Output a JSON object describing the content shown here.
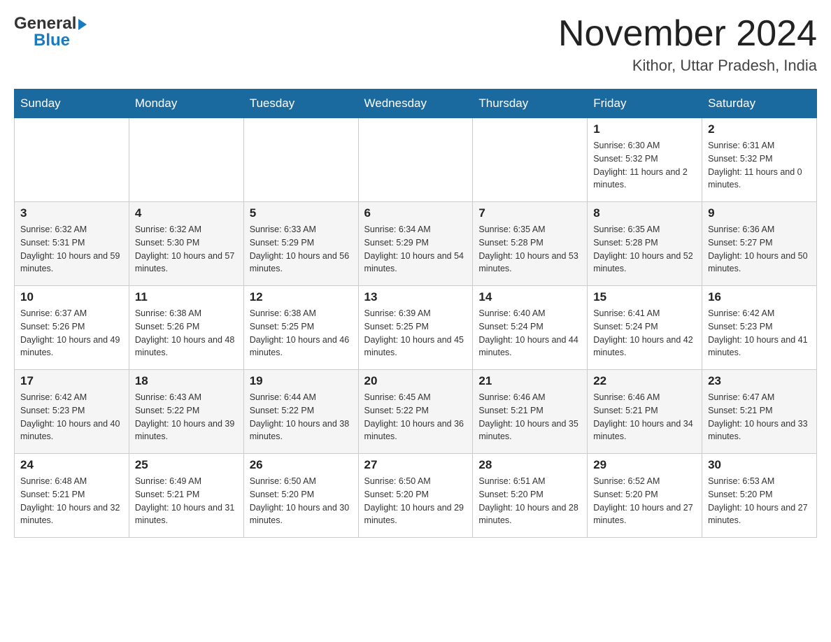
{
  "header": {
    "logo_general": "General",
    "logo_blue": "Blue",
    "month_title": "November 2024",
    "location": "Kithor, Uttar Pradesh, India"
  },
  "days_of_week": [
    "Sunday",
    "Monday",
    "Tuesday",
    "Wednesday",
    "Thursday",
    "Friday",
    "Saturday"
  ],
  "weeks": [
    [
      {
        "day": "",
        "info": ""
      },
      {
        "day": "",
        "info": ""
      },
      {
        "day": "",
        "info": ""
      },
      {
        "day": "",
        "info": ""
      },
      {
        "day": "",
        "info": ""
      },
      {
        "day": "1",
        "info": "Sunrise: 6:30 AM\nSunset: 5:32 PM\nDaylight: 11 hours and 2 minutes."
      },
      {
        "day": "2",
        "info": "Sunrise: 6:31 AM\nSunset: 5:32 PM\nDaylight: 11 hours and 0 minutes."
      }
    ],
    [
      {
        "day": "3",
        "info": "Sunrise: 6:32 AM\nSunset: 5:31 PM\nDaylight: 10 hours and 59 minutes."
      },
      {
        "day": "4",
        "info": "Sunrise: 6:32 AM\nSunset: 5:30 PM\nDaylight: 10 hours and 57 minutes."
      },
      {
        "day": "5",
        "info": "Sunrise: 6:33 AM\nSunset: 5:29 PM\nDaylight: 10 hours and 56 minutes."
      },
      {
        "day": "6",
        "info": "Sunrise: 6:34 AM\nSunset: 5:29 PM\nDaylight: 10 hours and 54 minutes."
      },
      {
        "day": "7",
        "info": "Sunrise: 6:35 AM\nSunset: 5:28 PM\nDaylight: 10 hours and 53 minutes."
      },
      {
        "day": "8",
        "info": "Sunrise: 6:35 AM\nSunset: 5:28 PM\nDaylight: 10 hours and 52 minutes."
      },
      {
        "day": "9",
        "info": "Sunrise: 6:36 AM\nSunset: 5:27 PM\nDaylight: 10 hours and 50 minutes."
      }
    ],
    [
      {
        "day": "10",
        "info": "Sunrise: 6:37 AM\nSunset: 5:26 PM\nDaylight: 10 hours and 49 minutes."
      },
      {
        "day": "11",
        "info": "Sunrise: 6:38 AM\nSunset: 5:26 PM\nDaylight: 10 hours and 48 minutes."
      },
      {
        "day": "12",
        "info": "Sunrise: 6:38 AM\nSunset: 5:25 PM\nDaylight: 10 hours and 46 minutes."
      },
      {
        "day": "13",
        "info": "Sunrise: 6:39 AM\nSunset: 5:25 PM\nDaylight: 10 hours and 45 minutes."
      },
      {
        "day": "14",
        "info": "Sunrise: 6:40 AM\nSunset: 5:24 PM\nDaylight: 10 hours and 44 minutes."
      },
      {
        "day": "15",
        "info": "Sunrise: 6:41 AM\nSunset: 5:24 PM\nDaylight: 10 hours and 42 minutes."
      },
      {
        "day": "16",
        "info": "Sunrise: 6:42 AM\nSunset: 5:23 PM\nDaylight: 10 hours and 41 minutes."
      }
    ],
    [
      {
        "day": "17",
        "info": "Sunrise: 6:42 AM\nSunset: 5:23 PM\nDaylight: 10 hours and 40 minutes."
      },
      {
        "day": "18",
        "info": "Sunrise: 6:43 AM\nSunset: 5:22 PM\nDaylight: 10 hours and 39 minutes."
      },
      {
        "day": "19",
        "info": "Sunrise: 6:44 AM\nSunset: 5:22 PM\nDaylight: 10 hours and 38 minutes."
      },
      {
        "day": "20",
        "info": "Sunrise: 6:45 AM\nSunset: 5:22 PM\nDaylight: 10 hours and 36 minutes."
      },
      {
        "day": "21",
        "info": "Sunrise: 6:46 AM\nSunset: 5:21 PM\nDaylight: 10 hours and 35 minutes."
      },
      {
        "day": "22",
        "info": "Sunrise: 6:46 AM\nSunset: 5:21 PM\nDaylight: 10 hours and 34 minutes."
      },
      {
        "day": "23",
        "info": "Sunrise: 6:47 AM\nSunset: 5:21 PM\nDaylight: 10 hours and 33 minutes."
      }
    ],
    [
      {
        "day": "24",
        "info": "Sunrise: 6:48 AM\nSunset: 5:21 PM\nDaylight: 10 hours and 32 minutes."
      },
      {
        "day": "25",
        "info": "Sunrise: 6:49 AM\nSunset: 5:21 PM\nDaylight: 10 hours and 31 minutes."
      },
      {
        "day": "26",
        "info": "Sunrise: 6:50 AM\nSunset: 5:20 PM\nDaylight: 10 hours and 30 minutes."
      },
      {
        "day": "27",
        "info": "Sunrise: 6:50 AM\nSunset: 5:20 PM\nDaylight: 10 hours and 29 minutes."
      },
      {
        "day": "28",
        "info": "Sunrise: 6:51 AM\nSunset: 5:20 PM\nDaylight: 10 hours and 28 minutes."
      },
      {
        "day": "29",
        "info": "Sunrise: 6:52 AM\nSunset: 5:20 PM\nDaylight: 10 hours and 27 minutes."
      },
      {
        "day": "30",
        "info": "Sunrise: 6:53 AM\nSunset: 5:20 PM\nDaylight: 10 hours and 27 minutes."
      }
    ]
  ]
}
